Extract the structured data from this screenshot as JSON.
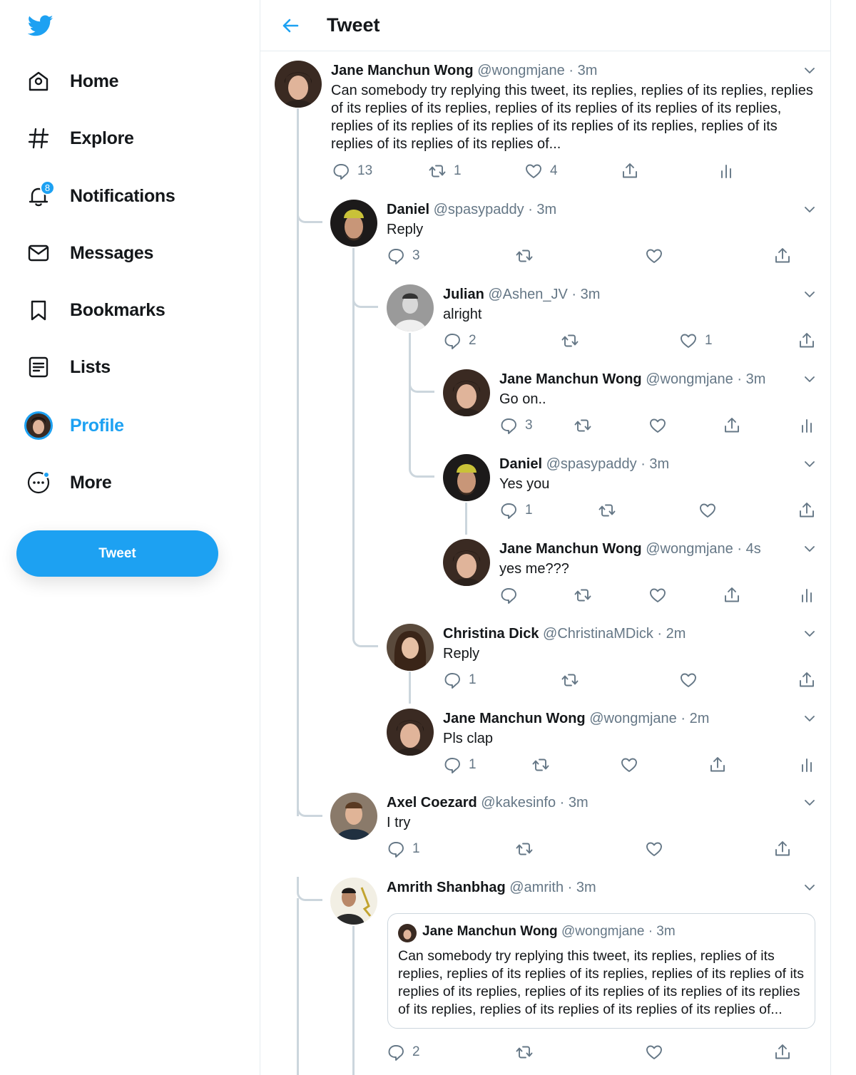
{
  "nav": {
    "items": [
      {
        "label": "Home",
        "icon": "home-icon"
      },
      {
        "label": "Explore",
        "icon": "hashtag-icon"
      },
      {
        "label": "Notifications",
        "icon": "bell-icon",
        "badge": "8"
      },
      {
        "label": "Messages",
        "icon": "envelope-icon"
      },
      {
        "label": "Bookmarks",
        "icon": "bookmark-icon"
      },
      {
        "label": "Lists",
        "icon": "list-icon"
      },
      {
        "label": "Profile",
        "icon": "avatar",
        "active": true
      },
      {
        "label": "More",
        "icon": "more-icon"
      }
    ],
    "tweet_button": "Tweet"
  },
  "header": {
    "title": "Tweet"
  },
  "colors": {
    "accent": "#1da1f2",
    "text": "#14171a",
    "muted": "#657786",
    "thread_line": "#ccd6dd"
  },
  "tweets": [
    {
      "name": "Jane Manchun Wong",
      "handle": "@wongmjane",
      "time": "· 3m",
      "text": "Can somebody try replying this tweet, its replies, replies of its replies, replies of its replies of its replies, replies of its replies of its replies of its replies, replies of its replies of its replies of its replies of its replies, replies of its replies of its replies of its replies of...",
      "replies": "13",
      "retweets": "1",
      "likes": "4"
    },
    {
      "name": "Daniel",
      "handle": "@spasypaddy",
      "time": "· 3m",
      "text": "Reply",
      "replies": "3",
      "retweets": "",
      "likes": ""
    },
    {
      "name": "Julian",
      "handle": "@Ashen_JV",
      "time": "· 3m",
      "text": "alright",
      "replies": "2",
      "retweets": "",
      "likes": "1"
    },
    {
      "name": "Jane Manchun Wong",
      "handle": "@wongmjane",
      "time": "· 3m",
      "text": "Go on..",
      "replies": "3",
      "retweets": "",
      "likes": ""
    },
    {
      "name": "Daniel",
      "handle": "@spasypaddy",
      "time": "· 3m",
      "text": "Yes you",
      "replies": "1",
      "retweets": "",
      "likes": ""
    },
    {
      "name": "Jane Manchun Wong",
      "handle": "@wongmjane",
      "time": "· 4s",
      "text": "yes me???",
      "replies": "",
      "retweets": "",
      "likes": ""
    },
    {
      "name": "Christina Dick",
      "handle": "@ChristinaMDick",
      "time": "· 2m",
      "text": "Reply",
      "replies": "1",
      "retweets": "",
      "likes": ""
    },
    {
      "name": "Jane Manchun Wong",
      "handle": "@wongmjane",
      "time": "· 2m",
      "text": "Pls clap",
      "replies": "1",
      "retweets": "",
      "likes": ""
    },
    {
      "name": "Axel Coezard",
      "handle": "@kakesinfo",
      "time": "· 3m",
      "text": "I try",
      "replies": "1",
      "retweets": "",
      "likes": ""
    },
    {
      "name": "Amrith Shanbhag",
      "handle": "@amrith",
      "time": "· 3m",
      "text": "",
      "replies": "2",
      "retweets": "",
      "likes": ""
    }
  ],
  "quote": {
    "name": "Jane Manchun Wong",
    "handle": "@wongmjane",
    "time": "· 3m",
    "text": "Can somebody try replying this tweet, its replies, replies of its replies, replies of its replies of its replies, replies of its replies of its replies of its replies, replies of its replies of its replies of its replies of its replies, replies of its replies of its replies of its replies of..."
  }
}
